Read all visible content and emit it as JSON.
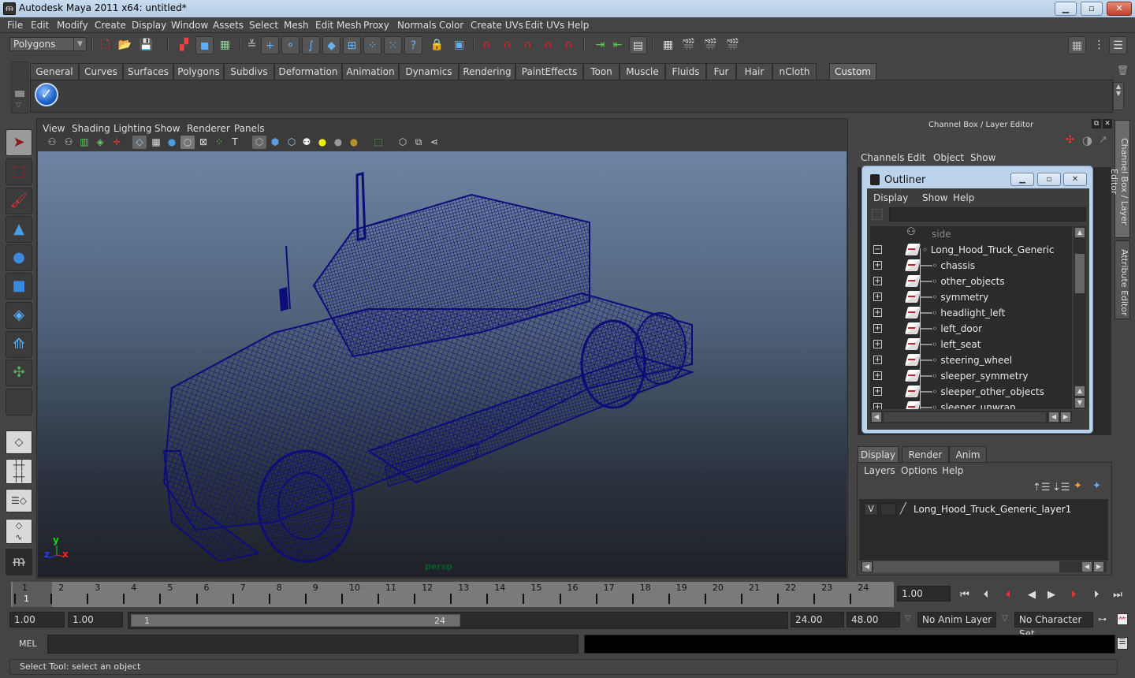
{
  "window": {
    "title": "Autodesk Maya 2011 x64: untitled*",
    "controls": {
      "minimize": "▁",
      "maximize": "▫",
      "close": "✕"
    }
  },
  "menubar": [
    "File",
    "Edit",
    "Modify",
    "Create",
    "Display",
    "Window",
    "Assets",
    "Select",
    "Mesh",
    "Edit Mesh",
    "Proxy",
    "Normals",
    "Color",
    "Create UVs",
    "Edit UVs",
    "Help"
  ],
  "toolbar": {
    "mode": "Polygons",
    "icons": [
      "new-scene-icon",
      "open-scene-icon",
      "save-scene-icon",
      "select-hierarchy-icon",
      "select-object-icon",
      "select-component-icon",
      "snap-menu-icon",
      "select-vertex-icon",
      "select-edge-icon",
      "select-face-icon",
      "select-uv-icon",
      "select-vertex-face-icon",
      "select-multi-icon",
      "select-help-icon",
      "lock-selection-icon",
      "highlight-selection-icon",
      "snap-to-grid-icon",
      "snap-to-curve-icon",
      "snap-to-point-icon",
      "snap-to-plane-icon",
      "make-live-icon",
      "input-ops-icon",
      "output-ops-icon",
      "construction-history-icon",
      "render-view-icon",
      "render-icon",
      "ipr-render-icon",
      "render-settings-icon"
    ],
    "right_icons": [
      "attribute-editor-toggle-icon",
      "tool-settings-toggle-icon",
      "channel-box-toggle-icon"
    ]
  },
  "shelf": {
    "tabs": [
      "General",
      "Curves",
      "Surfaces",
      "Polygons",
      "Subdivs",
      "Deformation",
      "Animation",
      "Dynamics",
      "Rendering",
      "PaintEffects",
      "Toon",
      "Muscle",
      "Fluids",
      "Fur",
      "Hair",
      "nCloth",
      "Custom"
    ],
    "active_tab": "Custom",
    "items": [
      "checkmark-icon"
    ]
  },
  "toolbox": {
    "tools": [
      "select-tool",
      "lasso-tool",
      "paint-select-tool",
      "move-tool",
      "rotate-tool",
      "scale-tool",
      "universal-manipulator-tool",
      "soft-modification-tool",
      "show-manipulator-tool",
      "last-tool"
    ],
    "active_tool": "select-tool"
  },
  "viewport": {
    "menu": [
      "View",
      "Shading",
      "Lighting",
      "Show",
      "Renderer",
      "Panels"
    ],
    "camera_label": "persp",
    "axis": {
      "x": "x",
      "y": "y",
      "z": "z"
    },
    "wireframe_color": "#0d0d7a"
  },
  "channel_box": {
    "title": "Channel Box / Layer Editor",
    "menu": [
      "Channels",
      "Edit",
      "Object",
      "Show"
    ]
  },
  "side_tabs": [
    "Channel Box / Layer Editor",
    "Attribute Editor"
  ],
  "outliner": {
    "title": "Outliner",
    "menu": [
      "Display",
      "Show",
      "Help"
    ],
    "filter_value": "",
    "items": [
      {
        "name": "side",
        "expander": "",
        "camera": true
      },
      {
        "name": "Long_Hood_Truck_Generic",
        "expander": "−"
      },
      {
        "name": "chassis",
        "expander": "+"
      },
      {
        "name": "other_objects",
        "expander": "+"
      },
      {
        "name": "symmetry",
        "expander": "+"
      },
      {
        "name": "headlight_left",
        "expander": "+"
      },
      {
        "name": "left_door",
        "expander": "+"
      },
      {
        "name": "left_seat",
        "expander": "+"
      },
      {
        "name": "steering_wheel",
        "expander": "+"
      },
      {
        "name": "sleeper_symmetry",
        "expander": "+"
      },
      {
        "name": "sleeper_other_objects",
        "expander": "+"
      },
      {
        "name": "sleeper_unwrap",
        "expander": "+"
      }
    ]
  },
  "layer_editor": {
    "tabs": [
      "Display",
      "Render",
      "Anim"
    ],
    "active_tab": "Display",
    "menu": [
      "Layers",
      "Options",
      "Help"
    ],
    "layers": [
      {
        "visible": "V",
        "name": "Long_Hood_Truck_Generic_layer1"
      }
    ]
  },
  "timeline": {
    "ticks": [
      "1",
      "2",
      "3",
      "4",
      "5",
      "6",
      "7",
      "8",
      "9",
      "10",
      "11",
      "12",
      "13",
      "14",
      "15",
      "16",
      "17",
      "18",
      "19",
      "20",
      "21",
      "22",
      "23",
      "24"
    ],
    "current_frame": "1",
    "current_time_field": "1.00",
    "playback": [
      "go-to-start-icon",
      "step-back-key-icon",
      "step-back-frame-icon",
      "play-backwards-icon",
      "play-forwards-icon",
      "step-forward-frame-icon",
      "step-forward-key-icon",
      "go-to-end-icon"
    ]
  },
  "range": {
    "start": "1.00",
    "playback_start": "1.00",
    "slider_start": "1",
    "slider_end": "24",
    "playback_end": "24.00",
    "end": "48.00",
    "anim_layer": "No Anim Layer",
    "character_set": "No Character Set"
  },
  "command_line": {
    "label": "MEL",
    "value": "",
    "output": ""
  },
  "status_line": "Select Tool: select an object"
}
